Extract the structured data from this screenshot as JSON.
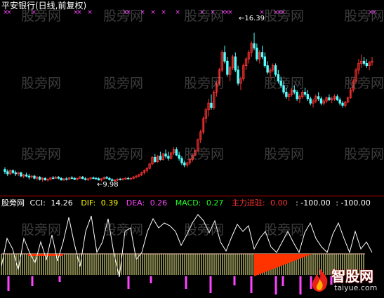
{
  "title": "平安银行(日线,前复权)",
  "price_high_label": "16.39",
  "price_low_label": "9.98",
  "indicator": {
    "name": "股旁网",
    "cci_label": "CCI:",
    "cci_value": "14.26",
    "dif_label": "DIF:",
    "dif_value": "0.39",
    "dea_label": "DEA:",
    "dea_value": "0.26",
    "macd_label": "MACD:",
    "macd_value": "0.27",
    "zljz_label": "主力进驻:",
    "zljz_value": "0.00",
    "extra1": ": -100.00",
    "extra2": ": -100.00"
  },
  "watermarks": [
    "股旁网",
    "股旁网",
    "股旁网",
    "股旁网",
    "股旁网",
    "股旁网",
    "股旁网",
    "股旁网",
    "股旁网",
    "股旁网",
    "股旁网",
    "股旁网",
    "股旁网",
    "股旁网",
    "股旁网",
    "股旁网",
    "股旁网",
    "股旁网",
    "股旁网"
  ],
  "brand": {
    "name": "智股网",
    "url": "taiyue.com"
  },
  "colors": {
    "background": "#000000",
    "up": "#ff3333",
    "down": "#55ffff",
    "cci": "#ffffff",
    "hist": "#ffff99",
    "signal": "#ff3300",
    "marker": "#ff44ff"
  },
  "chart_data": {
    "type": "candlestick",
    "price_range": [
      9.3,
      17.3
    ],
    "candles": [
      [
        10.2,
        10.3,
        10.0,
        10.1
      ],
      [
        10.1,
        10.2,
        9.9,
        10.0
      ],
      [
        10.0,
        10.2,
        9.95,
        10.15
      ],
      [
        10.15,
        10.2,
        10.0,
        10.05
      ],
      [
        10.05,
        10.15,
        9.9,
        10.0
      ],
      [
        10.0,
        10.1,
        9.9,
        10.05
      ],
      [
        10.05,
        10.1,
        9.85,
        9.9
      ],
      [
        9.9,
        10.0,
        9.8,
        9.95
      ],
      [
        9.95,
        10.05,
        9.85,
        9.9
      ],
      [
        9.9,
        10.0,
        9.75,
        9.85
      ],
      [
        9.85,
        9.95,
        9.8,
        9.9
      ],
      [
        9.9,
        9.95,
        9.75,
        9.8
      ],
      [
        9.8,
        9.9,
        9.7,
        9.85
      ],
      [
        9.85,
        9.9,
        9.7,
        9.75
      ],
      [
        9.75,
        9.85,
        9.65,
        9.8
      ],
      [
        9.8,
        9.85,
        9.7,
        9.72
      ],
      [
        9.72,
        9.8,
        9.65,
        9.75
      ],
      [
        9.75,
        9.85,
        9.7,
        9.82
      ],
      [
        9.82,
        9.9,
        9.75,
        9.8
      ],
      [
        9.8,
        9.9,
        9.78,
        9.85
      ],
      [
        9.85,
        9.9,
        9.75,
        9.8
      ],
      [
        9.8,
        9.85,
        9.7,
        9.72
      ],
      [
        9.72,
        9.8,
        9.68,
        9.78
      ],
      [
        9.78,
        9.85,
        9.7,
        9.75
      ],
      [
        9.75,
        9.85,
        9.72,
        9.82
      ],
      [
        9.82,
        9.9,
        9.76,
        9.8
      ],
      [
        9.8,
        9.85,
        9.72,
        9.75
      ],
      [
        9.75,
        9.82,
        9.7,
        9.8
      ],
      [
        9.8,
        9.9,
        9.78,
        9.86
      ],
      [
        9.86,
        9.9,
        9.76,
        9.78
      ],
      [
        9.78,
        9.85,
        9.7,
        9.74
      ],
      [
        9.74,
        9.8,
        9.68,
        9.78
      ],
      [
        9.78,
        9.85,
        9.72,
        9.82
      ],
      [
        9.82,
        9.88,
        9.76,
        9.8
      ],
      [
        9.8,
        9.86,
        9.74,
        9.78
      ],
      [
        9.78,
        9.84,
        9.7,
        9.72
      ],
      [
        9.72,
        9.8,
        9.66,
        9.78
      ],
      [
        9.78,
        9.88,
        9.74,
        9.84
      ],
      [
        9.84,
        9.9,
        9.76,
        9.8
      ],
      [
        9.8,
        9.86,
        9.7,
        9.74
      ],
      [
        9.74,
        9.8,
        9.66,
        9.7
      ],
      [
        9.7,
        9.76,
        9.62,
        9.72
      ],
      [
        9.72,
        9.8,
        9.68,
        9.76
      ],
      [
        9.76,
        9.82,
        9.7,
        9.74
      ],
      [
        9.74,
        9.8,
        9.7,
        9.78
      ],
      [
        9.78,
        9.85,
        9.72,
        9.8
      ],
      [
        9.8,
        9.86,
        9.74,
        9.78
      ],
      [
        9.78,
        9.84,
        9.72,
        9.8
      ],
      [
        9.8,
        9.9,
        9.76,
        9.86
      ],
      [
        9.86,
        9.95,
        9.8,
        9.9
      ],
      [
        9.9,
        10.0,
        9.84,
        9.96
      ],
      [
        9.96,
        10.1,
        9.9,
        10.05
      ],
      [
        10.05,
        10.2,
        9.98,
        10.15
      ],
      [
        10.15,
        10.3,
        10.05,
        10.25
      ],
      [
        10.25,
        10.5,
        10.2,
        10.45
      ],
      [
        10.45,
        10.8,
        10.4,
        10.75
      ],
      [
        10.75,
        10.9,
        10.5,
        10.55
      ],
      [
        10.55,
        10.85,
        10.5,
        10.8
      ],
      [
        10.8,
        11.0,
        10.6,
        10.65
      ],
      [
        10.65,
        10.95,
        10.6,
        10.9
      ],
      [
        10.9,
        11.1,
        10.7,
        10.8
      ],
      [
        10.8,
        11.0,
        10.6,
        10.7
      ],
      [
        10.7,
        11.0,
        10.65,
        10.95
      ],
      [
        10.95,
        11.2,
        10.85,
        11.1
      ],
      [
        11.1,
        11.2,
        10.8,
        10.85
      ],
      [
        10.85,
        11.0,
        10.6,
        10.7
      ],
      [
        10.7,
        10.8,
        10.4,
        10.5
      ],
      [
        10.5,
        10.6,
        10.3,
        10.4
      ],
      [
        10.4,
        10.55,
        10.3,
        10.5
      ],
      [
        10.5,
        10.7,
        10.4,
        10.65
      ],
      [
        10.65,
        10.9,
        10.55,
        10.85
      ],
      [
        10.85,
        11.1,
        10.8,
        11.05
      ],
      [
        11.05,
        11.6,
        11.0,
        11.55
      ],
      [
        11.55,
        12.0,
        11.4,
        11.9
      ],
      [
        11.9,
        12.6,
        11.8,
        12.5
      ],
      [
        12.5,
        13.0,
        12.3,
        12.9
      ],
      [
        12.9,
        13.4,
        12.6,
        13.2
      ],
      [
        13.2,
        13.6,
        12.9,
        13.0
      ],
      [
        13.0,
        13.8,
        12.9,
        13.7
      ],
      [
        13.7,
        14.2,
        13.5,
        14.1
      ],
      [
        14.1,
        14.8,
        14.0,
        14.7
      ],
      [
        14.7,
        15.6,
        14.6,
        15.5
      ],
      [
        15.5,
        15.8,
        15.0,
        15.1
      ],
      [
        15.1,
        15.3,
        14.4,
        14.5
      ],
      [
        14.5,
        14.9,
        14.2,
        14.8
      ],
      [
        14.8,
        15.4,
        14.7,
        15.3
      ],
      [
        15.3,
        15.5,
        14.6,
        14.7
      ],
      [
        14.7,
        14.9,
        14.0,
        14.1
      ],
      [
        14.1,
        14.4,
        13.8,
        14.3
      ],
      [
        14.3,
        15.0,
        14.2,
        14.9
      ],
      [
        14.9,
        15.3,
        14.7,
        15.2
      ],
      [
        15.2,
        15.6,
        15.0,
        15.5
      ],
      [
        15.5,
        16.0,
        15.3,
        15.9
      ],
      [
        15.9,
        16.39,
        15.6,
        15.7
      ],
      [
        15.7,
        15.9,
        15.1,
        15.2
      ],
      [
        15.2,
        15.6,
        15.0,
        15.5
      ],
      [
        15.5,
        15.8,
        15.2,
        15.3
      ],
      [
        15.3,
        15.5,
        14.8,
        14.9
      ],
      [
        14.9,
        15.1,
        14.5,
        14.6
      ],
      [
        14.6,
        14.8,
        14.3,
        14.7
      ],
      [
        14.7,
        15.0,
        14.6,
        14.9
      ],
      [
        14.9,
        15.0,
        14.4,
        14.5
      ],
      [
        14.5,
        14.7,
        14.1,
        14.2
      ],
      [
        14.2,
        14.4,
        13.9,
        14.0
      ],
      [
        14.0,
        14.2,
        13.6,
        13.7
      ],
      [
        13.7,
        13.9,
        13.4,
        13.5
      ],
      [
        13.5,
        13.7,
        13.3,
        13.6
      ],
      [
        13.6,
        13.9,
        13.5,
        13.8
      ],
      [
        13.8,
        14.0,
        13.6,
        13.7
      ],
      [
        13.7,
        13.8,
        13.3,
        13.4
      ],
      [
        13.4,
        13.6,
        13.2,
        13.5
      ],
      [
        13.5,
        13.8,
        13.4,
        13.7
      ],
      [
        13.7,
        13.9,
        13.5,
        13.6
      ],
      [
        13.6,
        13.8,
        13.3,
        13.4
      ],
      [
        13.4,
        13.5,
        13.1,
        13.2
      ],
      [
        13.2,
        13.4,
        13.0,
        13.3
      ],
      [
        13.3,
        13.6,
        13.2,
        13.5
      ],
      [
        13.5,
        13.7,
        13.3,
        13.4
      ],
      [
        13.4,
        13.5,
        13.1,
        13.2
      ],
      [
        13.2,
        13.4,
        13.1,
        13.3
      ],
      [
        13.3,
        13.5,
        13.2,
        13.45
      ],
      [
        13.45,
        13.6,
        13.3,
        13.35
      ],
      [
        13.35,
        13.5,
        13.2,
        13.4
      ],
      [
        13.4,
        13.6,
        13.3,
        13.5
      ],
      [
        13.5,
        13.6,
        13.3,
        13.35
      ],
      [
        13.35,
        13.45,
        13.1,
        13.2
      ],
      [
        13.2,
        13.3,
        13.0,
        13.1
      ],
      [
        13.1,
        13.3,
        13.0,
        13.25
      ],
      [
        13.25,
        13.5,
        13.2,
        13.45
      ],
      [
        13.45,
        13.9,
        13.4,
        13.8
      ],
      [
        13.8,
        14.3,
        13.7,
        14.2
      ],
      [
        14.2,
        14.8,
        14.1,
        14.7
      ],
      [
        14.7,
        15.2,
        14.5,
        15.0
      ],
      [
        15.0,
        15.4,
        14.8,
        15.1
      ],
      [
        15.1,
        15.3,
        14.9,
        15.0
      ],
      [
        15.0,
        15.2,
        14.8,
        14.9
      ],
      [
        14.9,
        15.1,
        14.7,
        15.05
      ],
      [
        15.05,
        15.3,
        14.9,
        15.1
      ]
    ]
  }
}
